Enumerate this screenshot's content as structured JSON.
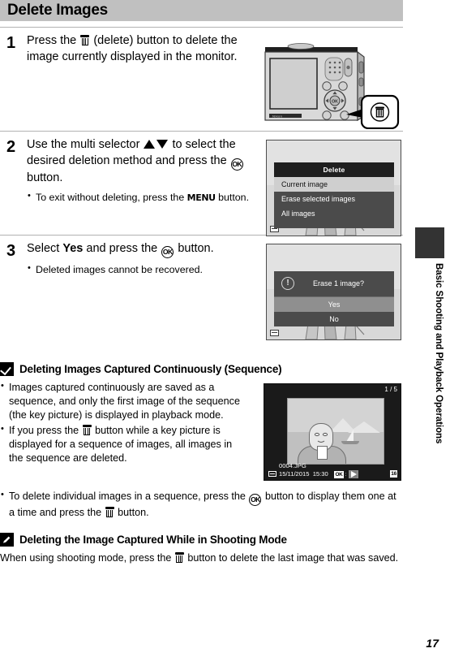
{
  "header": {
    "title": "Delete Images"
  },
  "steps": [
    {
      "num": "1",
      "text_before": "Press the",
      "icon": "trash-icon",
      "text_after": "(delete) button to delete the image currently displayed in the monitor.",
      "bullets": []
    },
    {
      "num": "2",
      "text_1": "Use the multi selector",
      "icon_up": "up-triangle-icon",
      "icon_down": "down-triangle-icon",
      "text_2": "to select the desired deletion method and press the",
      "icon_ok": "ok-button-icon",
      "text_3": "button.",
      "bullet_1a": "To exit without deleting, press the",
      "bullet_1b": "MENU",
      "bullet_1c": "button."
    },
    {
      "num": "3",
      "text_1": "Select",
      "emphasis": "Yes",
      "text_2": "and press the",
      "icon_ok": "ok-button-icon",
      "text_3": "button.",
      "bullet_1": "Deleted images cannot be recovered."
    }
  ],
  "delete_menu": {
    "title": "Delete",
    "items": [
      {
        "label": "Current image",
        "selected": true
      },
      {
        "label": "Erase selected images",
        "selected": false
      },
      {
        "label": "All images",
        "selected": false
      }
    ]
  },
  "erase_dialog": {
    "message": "Erase 1 image?",
    "warning_icon": "exclamation-circle-icon",
    "buttons": [
      {
        "label": "Yes",
        "selected": true
      },
      {
        "label": "No",
        "selected": false
      }
    ]
  },
  "note_sequence": {
    "icon": "checkmark-box-icon",
    "title": "Deleting Images Captured Continuously (Sequence)",
    "bullets": [
      "Images captured continuously are saved as a sequence, and only the first image of the sequence (the key picture) is displayed in playback mode.",
      "If you press the \u0001 button while a key picture is displayed for a sequence of images, all images in the sequence are deleted."
    ],
    "bullet3_a": "To delete individual images in a sequence, press the",
    "bullet3_b": "button to display them one at a time and press the",
    "bullet3_c": "button."
  },
  "playback_screen": {
    "frame_count": "1 / 5",
    "file_name": "0004.JPG",
    "date": "15/11/2015",
    "time": "15:30",
    "ok_label": "OK",
    "separator": ":",
    "image_size": "16",
    "card_icon": "memory-card-icon",
    "play_icon": "play-triangle-icon"
  },
  "note_shooting": {
    "icon": "pencil-box-icon",
    "title": "Deleting the Image Captured While in Shooting Mode",
    "text_a": "When using shooting mode, press the",
    "text_b": "button to delete the last image that was saved."
  },
  "sidebar": {
    "chapter": "Basic Shooting and Playback Operations",
    "tab": "chapter-tab"
  },
  "page_number": "17"
}
